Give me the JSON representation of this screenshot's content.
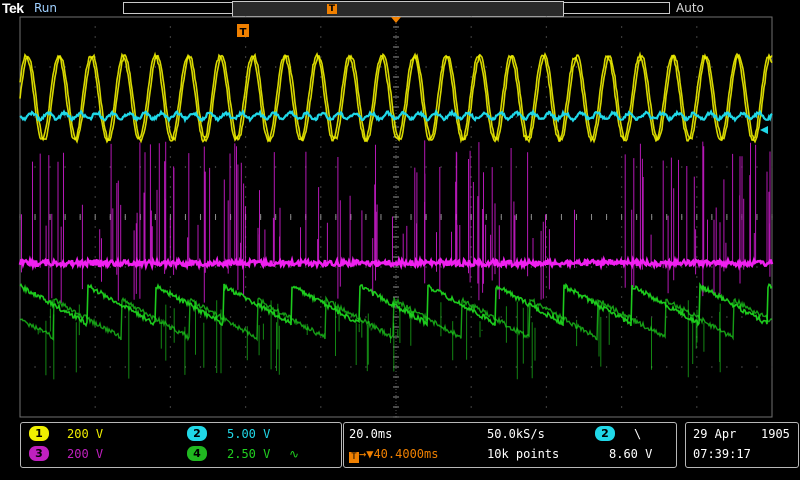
{
  "header": {
    "brand": "Tek",
    "acquisition_state": "Run",
    "trigger_mode": "Auto",
    "trigger_position_marker": "T"
  },
  "screen": {
    "trigger_marker": "T",
    "channel_markers": [
      {
        "label": "1",
        "color": "#e6e600"
      },
      {
        "label": "2",
        "color": "#20d0e0"
      },
      {
        "label": "3",
        "color": "#e020e0"
      },
      {
        "label": "4",
        "color": "#20c020"
      }
    ],
    "colors": {
      "ch1": "#f0f000",
      "ch2": "#20d8e8",
      "ch3": "#f020f0",
      "ch4": "#20e020",
      "grid": "#5a5a5a",
      "trigger": "#f08000"
    }
  },
  "channels_panel": {
    "ch1": {
      "label": "1",
      "scale": "200 V"
    },
    "ch2": {
      "label": "2",
      "scale": "5.00 V"
    },
    "ch3": {
      "label": "3",
      "scale": "200 V"
    },
    "ch4": {
      "label": "4",
      "scale": "2.50 V",
      "bandwidth_symbol": "∿"
    }
  },
  "timebase_panel": {
    "time_per_div": "20.0ms",
    "sample_rate": "50.0kS/s",
    "trigger_position": "40.4000ms",
    "record_length": "10k points"
  },
  "trigger_panel": {
    "source": "2",
    "slope_symbol": "\\",
    "level": "8.60 V"
  },
  "clock": {
    "date": "29 Apr",
    "year": "1905",
    "time": "07:39:17"
  }
}
